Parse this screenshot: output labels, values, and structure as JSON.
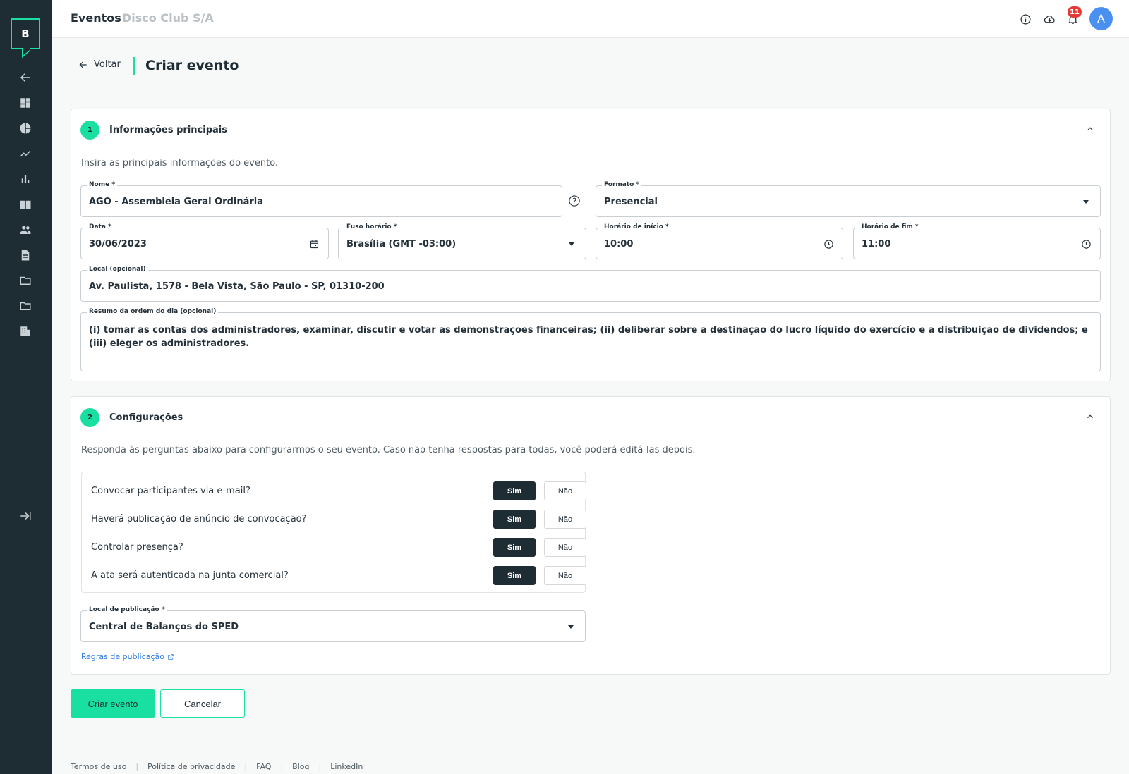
{
  "sidebar": {
    "logo_letter": "B",
    "items": [
      {
        "icon": "arrow-left-icon"
      },
      {
        "icon": "dashboard-icon"
      },
      {
        "icon": "pie-chart-icon"
      },
      {
        "icon": "trending-icon"
      },
      {
        "icon": "bar-chart-icon"
      },
      {
        "icon": "book-icon"
      },
      {
        "icon": "people-icon"
      },
      {
        "icon": "document-icon"
      },
      {
        "icon": "folder-icon"
      },
      {
        "icon": "folder-icon"
      },
      {
        "icon": "building-icon"
      }
    ],
    "expand_icon": "expand-sidebar-icon"
  },
  "header": {
    "title": "Eventos",
    "company": "Disco Club S/A",
    "notification_count": "11",
    "avatar_initial": "A"
  },
  "page": {
    "back_label": "Voltar",
    "title": "Criar evento"
  },
  "section1": {
    "step": "1",
    "title": "Informações principais",
    "description": "Insira as principais informações do evento.",
    "fields": {
      "nome": {
        "label": "Nome *",
        "value": "AGO - Assembleia Geral Ordinária"
      },
      "formato": {
        "label": "Formato *",
        "value": "Presencial"
      },
      "data": {
        "label": "Data *",
        "value": "30/06/2023"
      },
      "fuso": {
        "label": "Fuso horário *",
        "value": "Brasília (GMT -03:00)"
      },
      "inicio": {
        "label": "Horário de início *",
        "value": "10:00"
      },
      "fim": {
        "label": "Horário de fim *",
        "value": "11:00"
      },
      "local": {
        "label": "Local (opcional)",
        "value": "Av. Paulista, 1578 - Bela Vista, São Paulo - SP, 01310-200"
      },
      "resumo": {
        "label": "Resumo da ordem do dia (opcional)",
        "value": "(i) tomar as contas dos administradores, examinar, discutir e votar as demonstrações financeiras; (ii) deliberar sobre a destinação do lucro líquido do exercício e a distribuição de dividendos; e (iii) eleger os administradores."
      }
    }
  },
  "section2": {
    "step": "2",
    "title": "Configurações",
    "description": "Responda às perguntas abaixo para configurarmos o seu evento. Caso não tenha respostas para todas, você poderá editá-las depois.",
    "questions": [
      {
        "text": "Convocar participantes via e-mail?",
        "yes": "Sim",
        "no": "Não",
        "selected": "Sim"
      },
      {
        "text": "Haverá publicação de anúncio de convocação?",
        "yes": "Sim",
        "no": "Não",
        "selected": "Sim"
      },
      {
        "text": "Controlar presença?",
        "yes": "Sim",
        "no": "Não",
        "selected": "Sim"
      },
      {
        "text": "A ata será autenticada na junta comercial?",
        "yes": "Sim",
        "no": "Não",
        "selected": "Sim"
      }
    ],
    "publication": {
      "label": "Local de publicação *",
      "value": "Central de Balanços do SPED"
    },
    "rules_link": "Regras de publicação"
  },
  "actions": {
    "create": "Criar evento",
    "cancel": "Cancelar"
  },
  "footer": {
    "links": [
      "Termos de uso",
      "Política de privacidade",
      "FAQ",
      "Blog",
      "LinkedIn"
    ]
  },
  "colors": {
    "accent": "#19e0a0",
    "sidebar": "#1e2c33",
    "link": "#2f7de1",
    "badge": "#e53935",
    "avatar": "#4a90f0"
  }
}
